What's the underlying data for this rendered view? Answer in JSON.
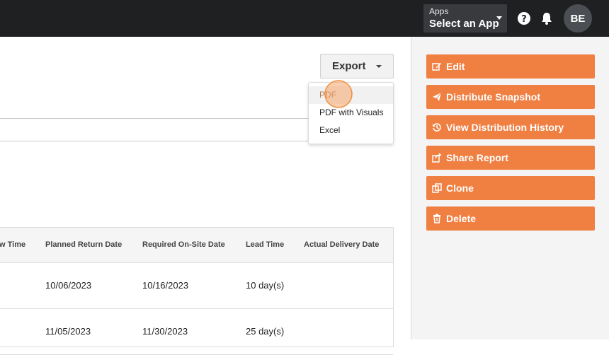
{
  "topbar": {
    "apps_label": "Apps",
    "apps_value": "Select an App",
    "user_initials": "BE"
  },
  "toolbar": {
    "export_label": "Export"
  },
  "export_menu": {
    "items": [
      "PDF",
      "PDF with Visuals",
      "Excel"
    ]
  },
  "table": {
    "headers": [
      "w Time",
      "Planned Return Date",
      "Required On-Site Date",
      "Lead Time",
      "Actual Delivery Date"
    ],
    "rows": [
      [
        "",
        "10/06/2023",
        "10/16/2023",
        "10 day(s)",
        ""
      ],
      [
        "",
        "11/05/2023",
        "11/30/2023",
        "25 day(s)",
        ""
      ]
    ]
  },
  "actions": [
    {
      "label": "Edit",
      "icon": "edit-icon"
    },
    {
      "label": "Distribute Snapshot",
      "icon": "paper-plane-icon"
    },
    {
      "label": "View Distribution History",
      "icon": "history-icon"
    },
    {
      "label": "Share Report",
      "icon": "share-icon"
    },
    {
      "label": "Clone",
      "icon": "clone-icon"
    },
    {
      "label": "Delete",
      "icon": "trash-icon"
    }
  ],
  "colors": {
    "topbar": "#1f2022",
    "accent": "#f07f42",
    "sidebar_bg": "#f4f4f4"
  }
}
